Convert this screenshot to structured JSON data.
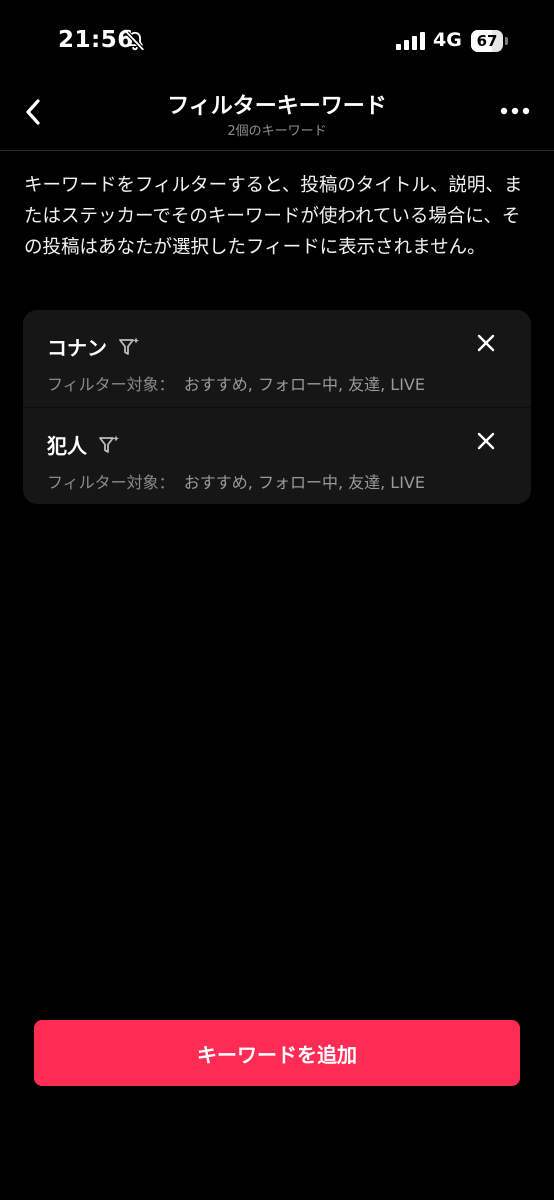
{
  "status_bar": {
    "time": "21:56",
    "network": "4G",
    "battery_level": "67",
    "battery_fraction": 0.67,
    "icons": [
      "bell-off-icon",
      "signal-icon",
      "battery-icon"
    ]
  },
  "header": {
    "title": "フィルターキーワード",
    "subtitle": "2個のキーワード",
    "icons": [
      "chevron-left-icon",
      "more-horizontal-icon"
    ]
  },
  "description": "キーワードをフィルターすると、投稿のタイトル、説明、またはステッカーでそのキーワードが使われている場合に、その投稿はあなたが選択したフィードに表示されません。",
  "keywords": [
    {
      "name": "コナン",
      "targets_label": "フィルター対象：",
      "targets": "おすすめ, フォロー中, 友達, LIVE",
      "icons": [
        "filter-sparkle-icon",
        "close-icon"
      ]
    },
    {
      "name": "犯人",
      "targets_label": "フィルター対象：",
      "targets": "おすすめ, フォロー中, 友達, LIVE",
      "icons": [
        "filter-sparkle-icon",
        "close-icon"
      ]
    }
  ],
  "add_button": {
    "label": "キーワードを追加"
  },
  "colors": {
    "background": "#000000",
    "card": "#161616",
    "accent": "#fe2c55",
    "secondary_text": "#8a8a8a"
  }
}
